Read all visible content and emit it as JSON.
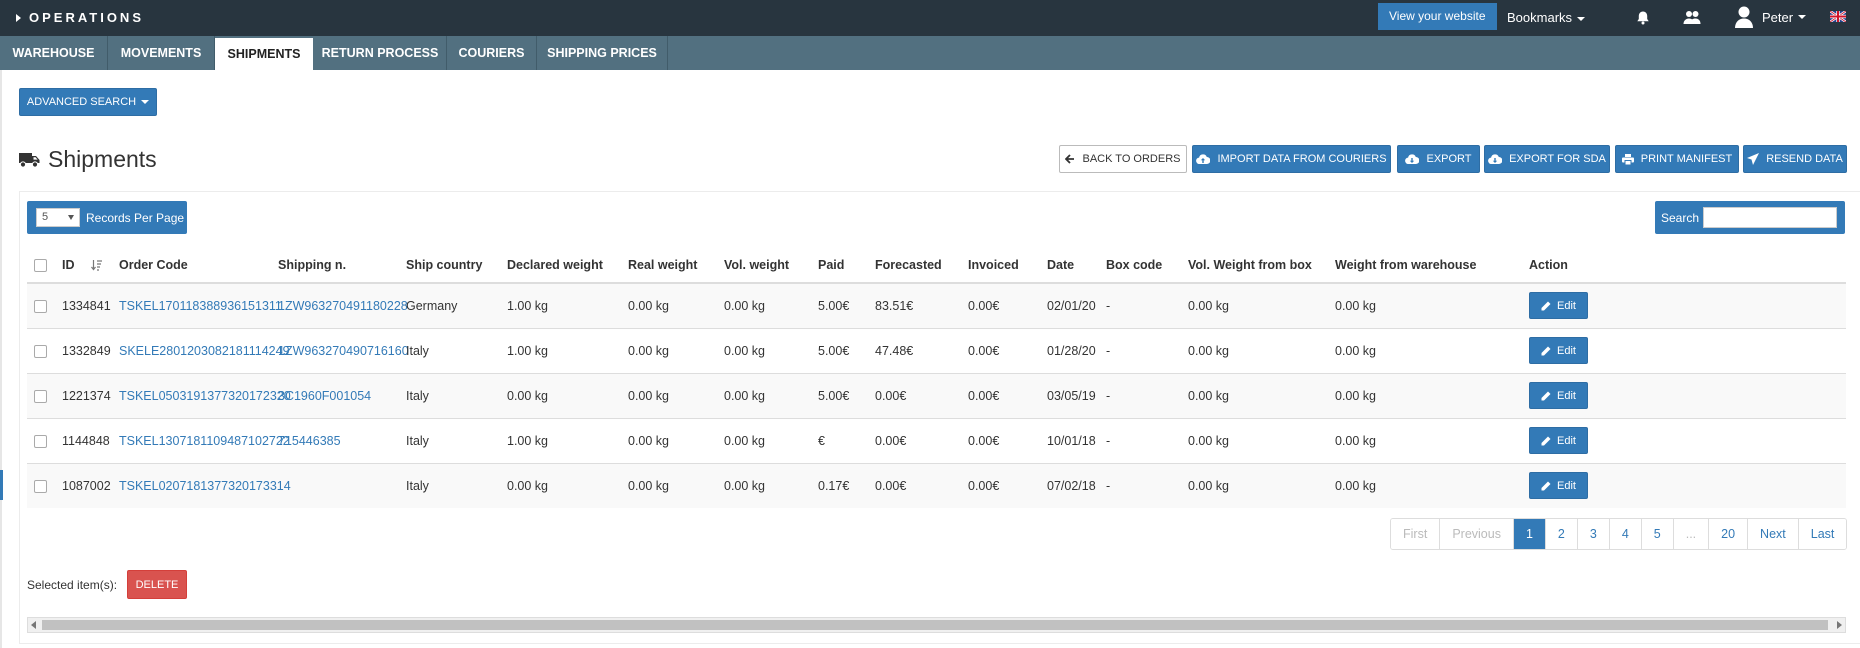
{
  "topbar": {
    "brand": "OPERATIONS",
    "view_site": "View your website",
    "bookmarks": "Bookmarks",
    "user": "Peter"
  },
  "tabs": [
    "WAREHOUSE",
    "MOVEMENTS",
    "SHIPMENTS",
    "RETURN PROCESS",
    "COURIERS",
    "SHIPPING PRICES"
  ],
  "advanced_search": "ADVANCED SEARCH",
  "page_title": "Shipments",
  "toolbar": {
    "back": "BACK TO ORDERS",
    "import": "IMPORT DATA FROM COURIERS",
    "export": "EXPORT",
    "export_sda": "EXPORT FOR SDA",
    "print": "PRINT MANIFEST",
    "resend": "RESEND DATA"
  },
  "records_per_page": {
    "value": "5",
    "label": "Records Per Page"
  },
  "search": {
    "label": "Search",
    "value": ""
  },
  "table": {
    "headers": [
      "ID",
      "Order Code",
      "Shipping n.",
      "Ship country",
      "Declared weight",
      "Real weight",
      "Vol. weight",
      "Paid",
      "Forecasted",
      "Invoiced",
      "Date",
      "Box code",
      "Vol. Weight from box",
      "Weight from warehouse",
      "Action"
    ],
    "edit_label": "Edit",
    "rows": [
      [
        "1334841",
        "TSKEL170118388936151311",
        "1ZW963270491180228",
        "Germany",
        "1.00 kg",
        "0.00 kg",
        "0.00 kg",
        "5.00€",
        "83.51€",
        "0.00€",
        "02/01/20",
        "-",
        "0.00 kg",
        "0.00 kg"
      ],
      [
        "1332849",
        "SKELE2801203082181114249",
        "1ZW963270490716160",
        "Italy",
        "1.00 kg",
        "0.00 kg",
        "0.00 kg",
        "5.00€",
        "47.48€",
        "0.00€",
        "01/28/20",
        "-",
        "0.00 kg",
        "0.00 kg"
      ],
      [
        "1221374",
        "TSKEL0503191377320172320",
        "3C1960F001054",
        "Italy",
        "0.00 kg",
        "0.00 kg",
        "0.00 kg",
        "5.00€",
        "0.00€",
        "0.00€",
        "03/05/19",
        "-",
        "0.00 kg",
        "0.00 kg"
      ],
      [
        "1144848",
        "TSKEL1307181109487102722",
        "715446385",
        "Italy",
        "1.00 kg",
        "0.00 kg",
        "0.00 kg",
        "€",
        "0.00€",
        "0.00€",
        "10/01/18",
        "-",
        "0.00 kg",
        "0.00 kg"
      ],
      [
        "1087002",
        "TSKEL0207181377320173314",
        "",
        "Italy",
        "0.00 kg",
        "0.00 kg",
        "0.00 kg",
        "0.17€",
        "0.00€",
        "0.00€",
        "07/02/18",
        "-",
        "0.00 kg",
        "0.00 kg"
      ]
    ]
  },
  "pagination": [
    "First",
    "Previous",
    "1",
    "2",
    "3",
    "4",
    "5",
    "...",
    "20",
    "Next",
    "Last"
  ],
  "pagination_current": "1",
  "selected_label": "Selected item(s):",
  "delete": "DELETE",
  "colors": {
    "topbar": "#28353f",
    "tabbar": "#527080",
    "primary": "#337ab7",
    "danger": "#d9534f"
  }
}
